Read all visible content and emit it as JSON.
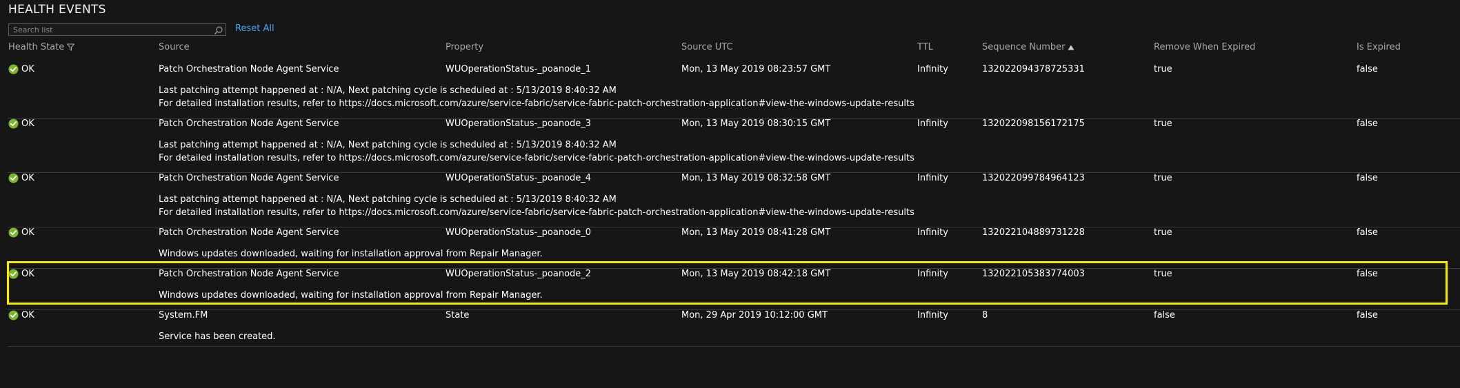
{
  "section": {
    "title": "HEALTH EVENTS"
  },
  "search": {
    "placeholder": "Search list",
    "value": ""
  },
  "reset_label": "Reset All",
  "columns": {
    "health_state": "Health State",
    "source": "Source",
    "property": "Property",
    "source_utc": "Source UTC",
    "ttl": "TTL",
    "sequence_number": "Sequence Number",
    "remove_when_expired": "Remove When Expired",
    "is_expired": "Is Expired"
  },
  "icons": {
    "status_ok": "check-circle-icon",
    "filter": "filter-icon",
    "sort": "sort-ascending-icon",
    "search": "search-icon"
  },
  "colors": {
    "ok_green": "#7bb72b",
    "link_blue": "#3ea8f5",
    "highlight": "#f5ec00"
  },
  "rows": [
    {
      "state": "OK",
      "source": "Patch Orchestration Node Agent Service",
      "property": "WUOperationStatus-_poanode_1",
      "source_utc": "Mon, 13 May 2019 08:23:57 GMT",
      "ttl": "Infinity",
      "sequence_number": "132022094378725331",
      "remove_when_expired": "true",
      "is_expired": "false",
      "description": [
        "Last patching attempt happened at : N/A, Next patching cycle is scheduled at : 5/13/2019 8:40:32 AM",
        "For detailed installation results, refer to https://docs.microsoft.com/azure/service-fabric/service-fabric-patch-orchestration-application#view-the-windows-update-results"
      ]
    },
    {
      "state": "OK",
      "source": "Patch Orchestration Node Agent Service",
      "property": "WUOperationStatus-_poanode_3",
      "source_utc": "Mon, 13 May 2019 08:30:15 GMT",
      "ttl": "Infinity",
      "sequence_number": "132022098156172175",
      "remove_when_expired": "true",
      "is_expired": "false",
      "description": [
        "Last patching attempt happened at : N/A, Next patching cycle is scheduled at : 5/13/2019 8:40:32 AM",
        "For detailed installation results, refer to https://docs.microsoft.com/azure/service-fabric/service-fabric-patch-orchestration-application#view-the-windows-update-results"
      ]
    },
    {
      "state": "OK",
      "source": "Patch Orchestration Node Agent Service",
      "property": "WUOperationStatus-_poanode_4",
      "source_utc": "Mon, 13 May 2019 08:32:58 GMT",
      "ttl": "Infinity",
      "sequence_number": "132022099784964123",
      "remove_when_expired": "true",
      "is_expired": "false",
      "description": [
        "Last patching attempt happened at : N/A, Next patching cycle is scheduled at : 5/13/2019 8:40:32 AM",
        "For detailed installation results, refer to https://docs.microsoft.com/azure/service-fabric/service-fabric-patch-orchestration-application#view-the-windows-update-results"
      ]
    },
    {
      "state": "OK",
      "source": "Patch Orchestration Node Agent Service",
      "property": "WUOperationStatus-_poanode_0",
      "source_utc": "Mon, 13 May 2019 08:41:28 GMT",
      "ttl": "Infinity",
      "sequence_number": "132022104889731228",
      "remove_when_expired": "true",
      "is_expired": "false",
      "description": [
        "Windows updates downloaded, waiting for installation approval from Repair Manager."
      ]
    },
    {
      "state": "OK",
      "source": "Patch Orchestration Node Agent Service",
      "property": "WUOperationStatus-_poanode_2",
      "source_utc": "Mon, 13 May 2019 08:42:18 GMT",
      "ttl": "Infinity",
      "sequence_number": "132022105383774003",
      "remove_when_expired": "true",
      "is_expired": "false",
      "description": [
        "Windows updates downloaded, waiting for installation approval from Repair Manager."
      ]
    },
    {
      "state": "OK",
      "source": "System.FM",
      "property": "State",
      "source_utc": "Mon, 29 Apr 2019 10:12:00 GMT",
      "ttl": "Infinity",
      "sequence_number": "8",
      "remove_when_expired": "false",
      "is_expired": "false",
      "description": [
        "Service has been created."
      ]
    }
  ]
}
